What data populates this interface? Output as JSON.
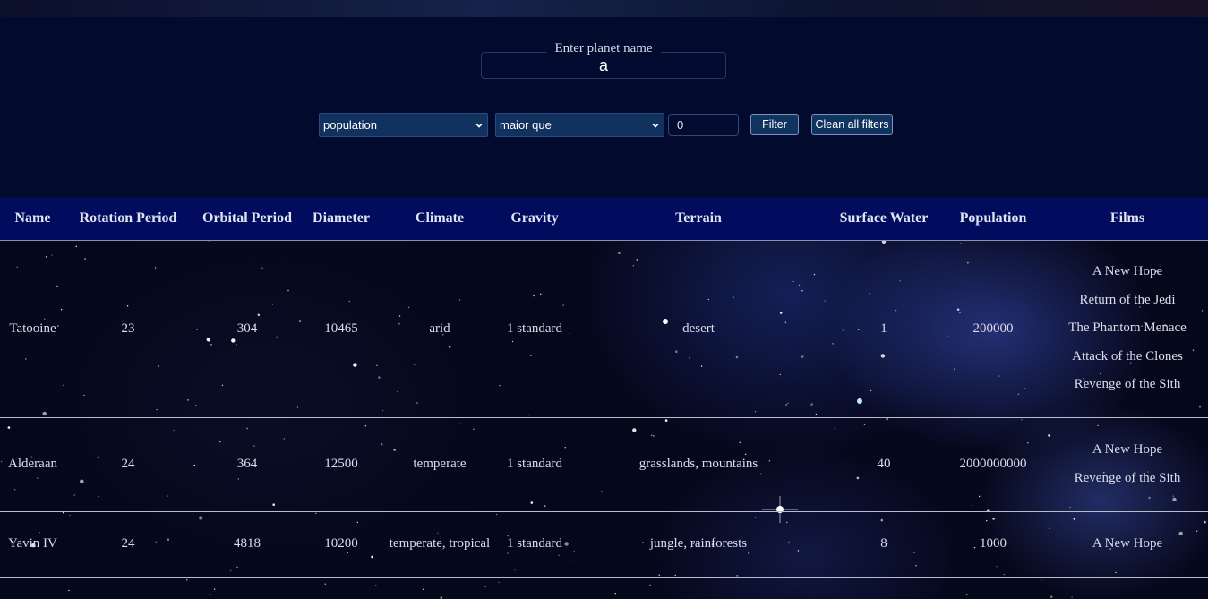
{
  "search": {
    "label": "Enter planet name",
    "value": "a"
  },
  "filters": {
    "column_select": "population",
    "comparison_select": "maior que",
    "value": "0",
    "filter_button": "Filter",
    "clear_button": "Clean all filters"
  },
  "table": {
    "headers": [
      "Name",
      "Rotation Period",
      "Orbital Period",
      "Diameter",
      "Climate",
      "Gravity",
      "Terrain",
      "Surface Water",
      "Population",
      "Films"
    ],
    "rows": [
      {
        "name": "Tatooine",
        "rotation_period": "23",
        "orbital_period": "304",
        "diameter": "10465",
        "climate": "arid",
        "gravity": "1 standard",
        "terrain": "desert",
        "surface_water": "1",
        "population": "200000",
        "films": [
          "A New Hope",
          "Return of the Jedi",
          "The Phantom Menace",
          "Attack of the Clones",
          "Revenge of the Sith"
        ]
      },
      {
        "name": "Alderaan",
        "rotation_period": "24",
        "orbital_period": "364",
        "diameter": "12500",
        "climate": "temperate",
        "gravity": "1 standard",
        "terrain": "grasslands, mountains",
        "surface_water": "40",
        "population": "2000000000",
        "films": [
          "A New Hope",
          "Revenge of the Sith"
        ]
      },
      {
        "name": "Yavin IV",
        "rotation_period": "24",
        "orbital_period": "4818",
        "diameter": "10200",
        "climate": "temperate, tropical",
        "gravity": "1 standard",
        "terrain": "jungle, rainforests",
        "surface_water": "8",
        "population": "1000",
        "films": [
          "A New Hope"
        ]
      }
    ]
  },
  "colors": {
    "header_bg": "#020a2d",
    "table_head_bg": "#010c5e",
    "control_bg": "#11325e",
    "space_bg": "#05071a"
  },
  "icons": {
    "select_arrow": "chevron-down-icon"
  }
}
